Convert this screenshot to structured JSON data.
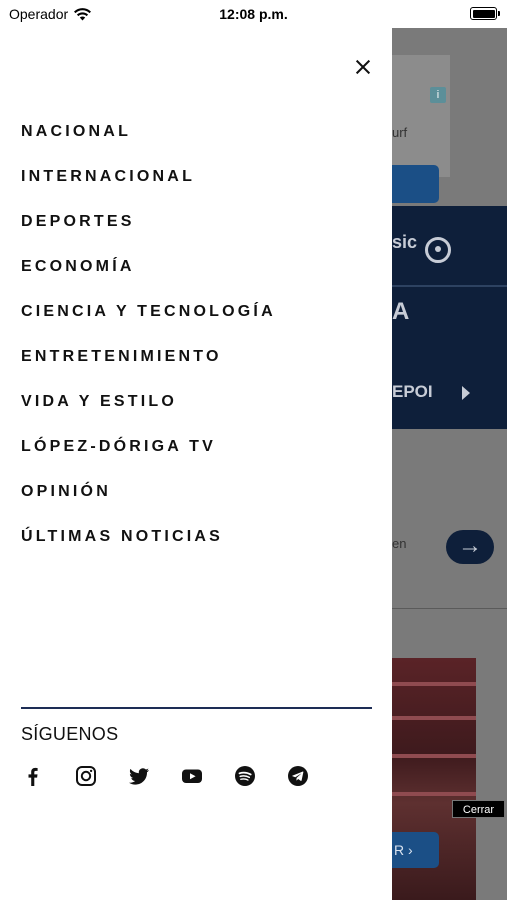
{
  "status_bar": {
    "carrier": "Operador",
    "time": "12:08 p.m."
  },
  "background": {
    "ad_text": "urf",
    "ad_info": "i",
    "music_text": "sic",
    "letter": "A",
    "section_text": "EPOI",
    "read_text": "en",
    "more_text": "R ›",
    "cerrar": "Cerrar"
  },
  "menu": {
    "items": [
      {
        "label": "NACIONAL"
      },
      {
        "label": "INTERNACIONAL"
      },
      {
        "label": "DEPORTES"
      },
      {
        "label": "ECONOMÍA"
      },
      {
        "label": "CIENCIA Y TECNOLOGÍA"
      },
      {
        "label": "ENTRETENIMIENTO"
      },
      {
        "label": "VIDA Y ESTILO"
      },
      {
        "label": "LÓPEZ-DÓRIGA TV"
      },
      {
        "label": "OPINIÓN"
      },
      {
        "label": "ÚLTIMAS NOTICIAS"
      }
    ]
  },
  "follow": {
    "title": "SÍGUENOS",
    "icons": [
      "facebook-icon",
      "instagram-icon",
      "twitter-icon",
      "youtube-icon",
      "spotify-icon",
      "telegram-icon"
    ]
  },
  "colors": {
    "divider": "#1d2d55",
    "navy": "#0e1f3a",
    "accent_blue": "#1b4f86"
  }
}
